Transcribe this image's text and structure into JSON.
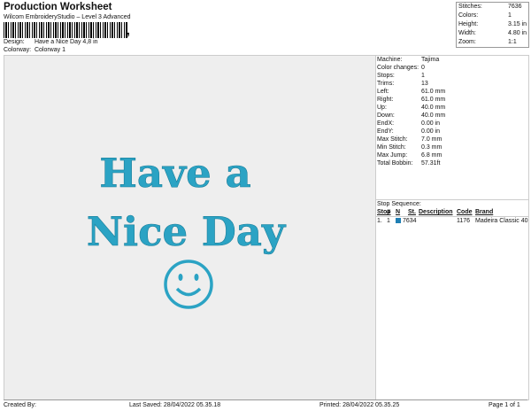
{
  "header": {
    "title": "Production Worksheet",
    "subtitle": "Wilcom EmbroideryStudio – Level 3 Advanced",
    "design_label": "Design:",
    "design_value": "Have a Nice Day 4,8 in",
    "colorway_label": "Colorway:",
    "colorway_value": "Colorway 1"
  },
  "stats": [
    {
      "label": "Stitches:",
      "value": "7636"
    },
    {
      "label": "Colors:",
      "value": "1"
    },
    {
      "label": "Height:",
      "value": "3.15 in"
    },
    {
      "label": "Width:",
      "value": "4.80 in"
    },
    {
      "label": "Zoom:",
      "value": "1:1"
    }
  ],
  "preview": {
    "line1": "Have a",
    "line2": "Nice Day",
    "thread_color": "#2ba3c4",
    "smiley_icon": "smiley-face-icon"
  },
  "machine_info": [
    {
      "label": "Machine:",
      "value": "Tajima"
    },
    {
      "label": "Color changes:",
      "value": "0"
    },
    {
      "label": "Stops:",
      "value": "1"
    },
    {
      "label": "Trims:",
      "value": "13"
    },
    {
      "label": "Left:",
      "value": "61.0 mm"
    },
    {
      "label": "Right:",
      "value": "61.0 mm"
    },
    {
      "label": "Up:",
      "value": "40.0 mm"
    },
    {
      "label": "Down:",
      "value": "40.0 mm"
    },
    {
      "label": "EndX:",
      "value": "0.00 in"
    },
    {
      "label": "EndY:",
      "value": "0.00 in"
    },
    {
      "label": "Max Stitch:",
      "value": "7.0 mm"
    },
    {
      "label": "Min Stitch:",
      "value": "0.3 mm"
    },
    {
      "label": "Max Jump:",
      "value": "6.8 mm"
    },
    {
      "label": "Total Bobbin:",
      "value": "57.31ft"
    }
  ],
  "stop_sequence": {
    "title": "Stop Sequence:",
    "columns": [
      "Stop",
      "#",
      "N",
      "St.",
      "Description",
      "Code",
      "Brand"
    ],
    "rows": [
      {
        "stop": "1.",
        "num": "1",
        "swatch": "#1f7fb4",
        "stitches": "7634",
        "description": "",
        "code": "1176",
        "brand": "Madeira Classic 40"
      }
    ]
  },
  "footer": {
    "created": "Created By:",
    "saved": "Last Saved: 28/04/2022 05.35.18",
    "printed": "Printed: 28/04/2022 05.35.25",
    "page": "Page 1 of 1"
  }
}
